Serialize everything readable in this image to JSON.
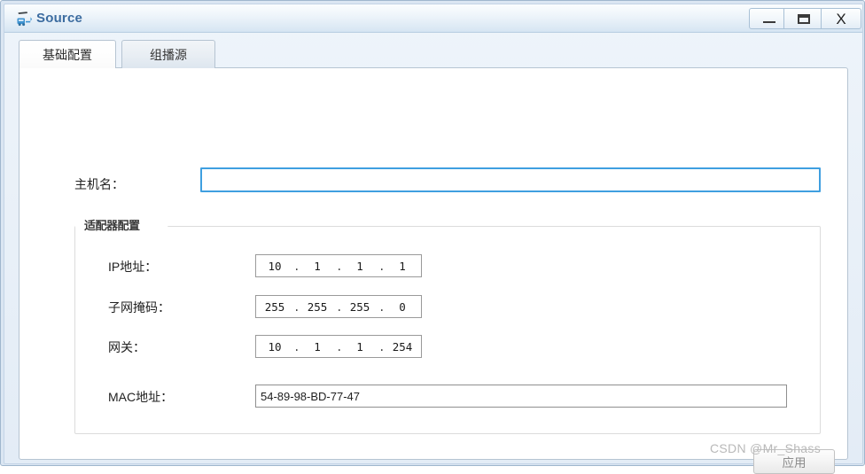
{
  "window": {
    "title": "Source",
    "icon": "network-device-icon",
    "controls": {
      "minimize": {
        "name": "minimize-button",
        "glyph": "–"
      },
      "maximize": {
        "name": "maximize-button",
        "glyph": "□"
      },
      "close": {
        "name": "close-button",
        "glyph": "X"
      }
    }
  },
  "tabs": [
    {
      "label": "基础配置",
      "active": true
    },
    {
      "label": "组播源",
      "active": false
    }
  ],
  "form": {
    "hostname": {
      "label": "主机名：",
      "value": "",
      "placeholder": ""
    },
    "group": {
      "title": "适配器配置",
      "ip": {
        "label": "IP地址：",
        "octets": [
          "10",
          "1",
          "1",
          "1"
        ],
        "separator": "."
      },
      "mask": {
        "label": "子网掩码：",
        "octets": [
          "255",
          "255",
          "255",
          "0"
        ],
        "separator": "."
      },
      "gateway": {
        "label": "网关：",
        "octets": [
          "10",
          "1",
          "1",
          "254"
        ],
        "separator": "."
      },
      "mac": {
        "label": "MAC地址：",
        "value": "54-89-98-BD-77-47"
      }
    }
  },
  "apply_button": {
    "label": "应用",
    "enabled": false
  },
  "watermark": "CSDN @Mr_Shass",
  "colors": {
    "title_text": "#3c6ca0",
    "titlebar_gradient_top": "#fbfdfe",
    "titlebar_gradient_bottom": "#cddff0",
    "window_border": "#9fb6cd",
    "focus_input_border": "#3f9fe0",
    "field_border": "#9a9a9a",
    "tab_active_bg": "#ffffff",
    "tab_inactive_bg": "#e7edf3",
    "disabled_button_text": "#8c8c8c",
    "watermark": "#b9b9b9"
  }
}
